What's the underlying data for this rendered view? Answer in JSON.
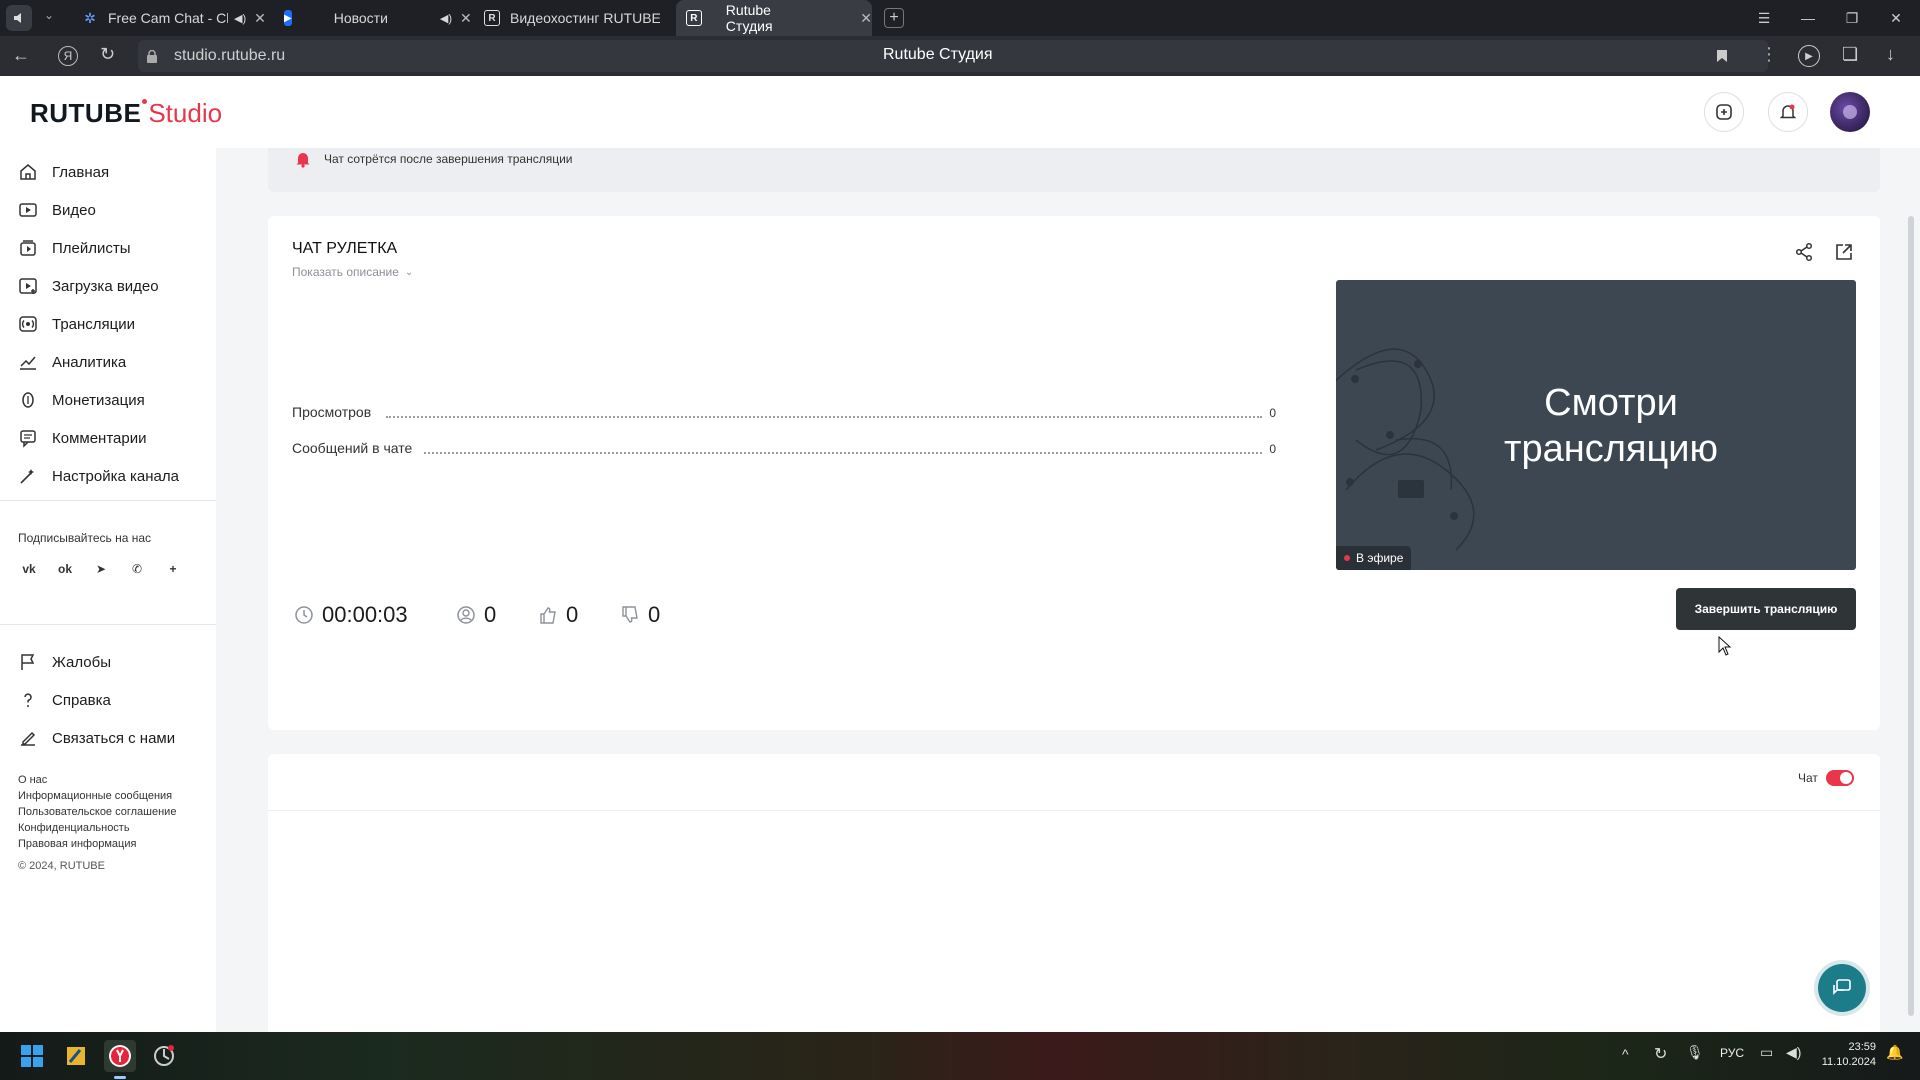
{
  "browser": {
    "tabs": [
      {
        "title": "Free Cam Chat - Cha",
        "active": false
      },
      {
        "title": "Новости",
        "active": false
      },
      {
        "title": "Видеохостинг RUTUBE. С",
        "active": false
      },
      {
        "title": "Rutube Студия",
        "active": true
      }
    ],
    "address": "studio.rutube.ru",
    "page_title": "Rutube Студия"
  },
  "header": {
    "logo_main": "RUTUBE",
    "logo_sub": "Studio"
  },
  "sidebar": {
    "items": [
      {
        "label": "Главная",
        "icon": "home-icon"
      },
      {
        "label": "Видео",
        "icon": "video-icon"
      },
      {
        "label": "Плейлисты",
        "icon": "playlist-icon"
      },
      {
        "label": "Загрузка видео",
        "icon": "upload-icon"
      },
      {
        "label": "Трансляции",
        "icon": "broadcast-icon"
      },
      {
        "label": "Аналитика",
        "icon": "analytics-icon"
      },
      {
        "label": "Монетизация",
        "icon": "monetization-icon"
      },
      {
        "label": "Комментарии",
        "icon": "comments-icon"
      },
      {
        "label": "Настройка канала",
        "icon": "channel-settings-icon"
      }
    ],
    "follow_label": "Подписывайтесь на нас",
    "social": [
      "vk-icon",
      "ok-icon",
      "telegram-icon",
      "viber-icon",
      "more-icon"
    ],
    "lower_items": [
      {
        "label": "Жалобы",
        "icon": "flag-icon"
      },
      {
        "label": "Справка",
        "icon": "help-icon"
      },
      {
        "label": "Связаться с нами",
        "icon": "contact-icon"
      }
    ],
    "footer_links": [
      "О нас",
      "Информационные сообщения",
      "Пользовательское соглашение",
      "Конфиденциальность",
      "Правовая информация"
    ],
    "copyright": "© 2024, RUTUBE"
  },
  "notice": {
    "text": "Чат сотрётся после завершения трансляции"
  },
  "stream": {
    "title": "ЧАТ РУЛЕТКА",
    "show_description": "Показать описание",
    "stats": [
      {
        "label": "Просмотров",
        "value": "0"
      },
      {
        "label": "Сообщений в чате",
        "value": "0"
      }
    ],
    "preview_text_line1": "Смотри",
    "preview_text_line2": "трансляцию",
    "live_badge": "В эфире",
    "duration": "00:00:03",
    "viewers": "0",
    "likes": "0",
    "dislikes": "0",
    "end_button": "Завершить трансляцию"
  },
  "chat_panel": {
    "toggle_label": "Чат",
    "toggle_on": true
  },
  "taskbar": {
    "lang": "РУС",
    "time": "23:59",
    "date": "11.10.2024"
  },
  "colors": {
    "accent_red": "#e8374b",
    "dark_button": "#2f3437",
    "preview_bg": "#3d4752",
    "support_teal": "#1d7c8a"
  }
}
